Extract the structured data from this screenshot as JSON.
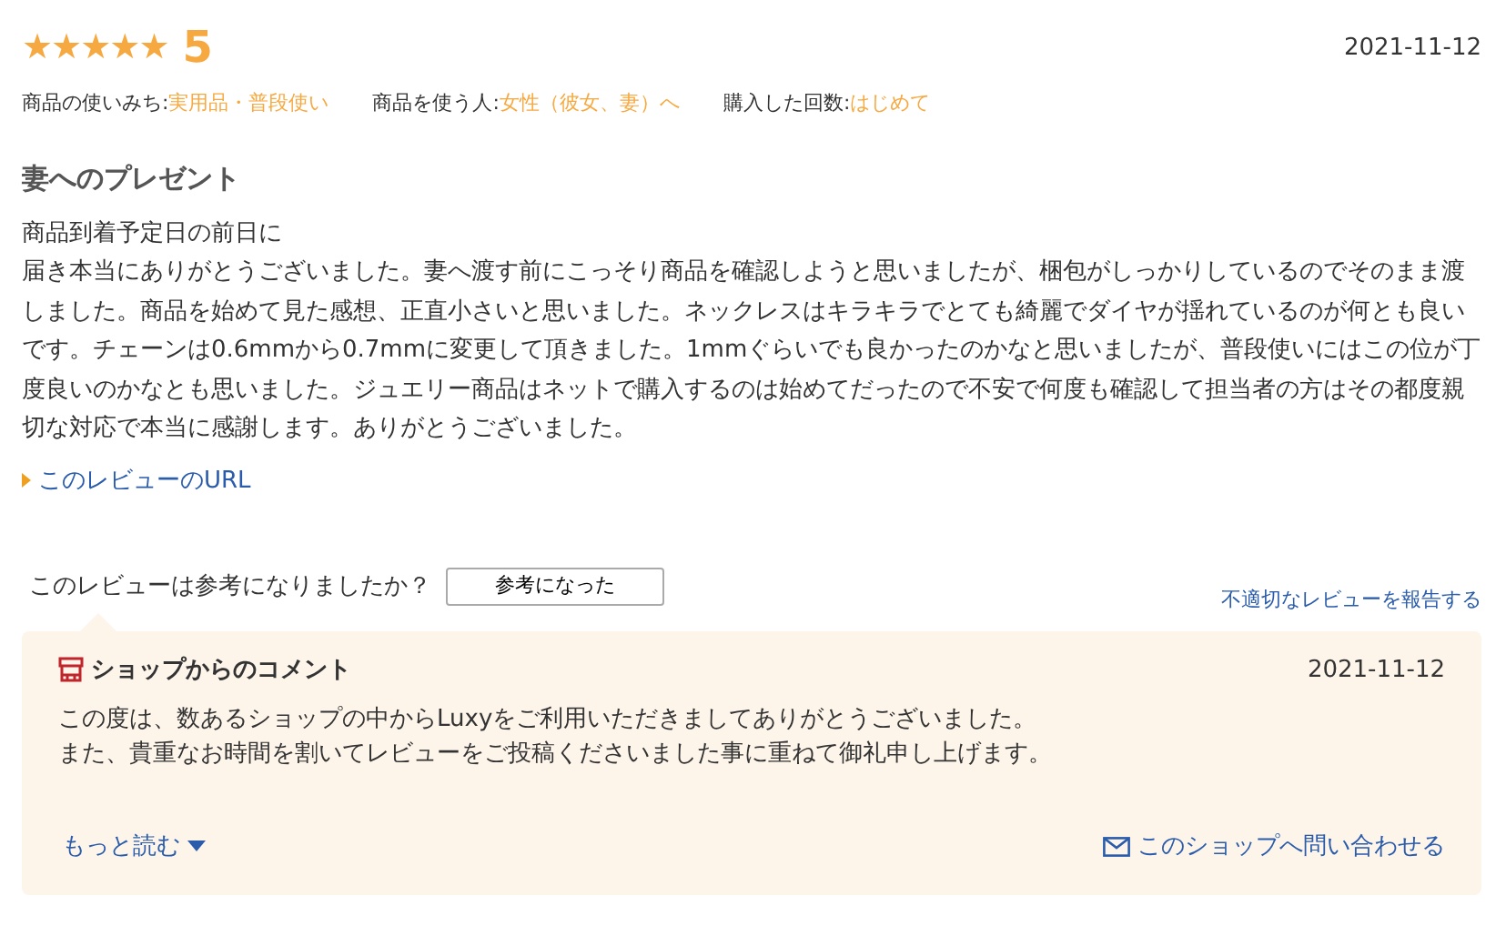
{
  "review": {
    "stars": 5,
    "score": "5",
    "date": "2021-11-12",
    "meta": [
      {
        "label": "商品の使いみち:",
        "value": "実用品・普段使い"
      },
      {
        "label": "商品を使う人:",
        "value": "女性（彼女、妻）へ"
      },
      {
        "label": "購入した回数:",
        "value": "はじめて"
      }
    ],
    "title": "妻へのプレゼント",
    "body": [
      "商品到着予定日の前日に",
      "届き本当にありがとうございました。妻へ渡す前にこっそり商品を確認しようと思いましたが、梱包がしっかりしているのでそのまま渡しました。商品を始めて見た感想、正直小さいと思いました。ネックレスはキラキラでとても綺麗でダイヤが揺れているのが何とも良いです。チェーンは0.6mmから0.7mmに変更して頂きました。1mmぐらいでも良かったのかなと思いましたが、普段使いにはこの位が丁度良いのかなとも思いました。ジュエリー商品はネットで購入するのは始めてだったので不安で何度も確認して担当者の方はその都度親切な対応で本当に感謝します。ありがとうございました。"
    ],
    "url_link": "このレビューのURL"
  },
  "helpful": {
    "question": "このレビューは参考になりましたか？",
    "button": "参考になった",
    "report_link": "不適切なレビューを報告する"
  },
  "shop_comment": {
    "title": "ショップからのコメント",
    "date": "2021-11-12",
    "lines": [
      "この度は、数あるショップの中からLuxyをご利用いただきましてありがとうございました。",
      "また、貴重なお時間を割いてレビューをご投稿くださいました事に重ねて御礼申し上げます。"
    ],
    "more_link": "もっと読む",
    "contact_link": "このショップへ問い合わせる"
  }
}
